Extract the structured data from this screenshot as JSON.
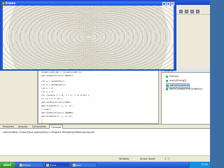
{
  "frame": {
    "title": "Frame",
    "buttons": {
      "minimize": "_",
      "maximize": "□",
      "close": "×"
    }
  },
  "editor": {
    "lines": [
      "Graphics2D g2d = (Graphics2D) g;",
      "g2d.setPaint(Color.WHITE);",
      "int w = getWidth();",
      "int h = getHeight();",
      "int x = 0;",
      "int y = 0;",
      "for (double f = 0; f < 1; f += 0.01) {",
      "  if (f % 2 == 0) {",
      "    g2d.setPaint(Color.RED);",
      "    g2d.drawOval(x, y, w, h);",
      "  } else {",
      "    g2d.setPaint(Color.GREEN);",
      "    g2d.drawOval(x, y, w, h);",
      "  }",
      "}"
    ]
  },
  "outline": {
    "tab_label": "Outline",
    "items": [
      {
        "label": "Frame()"
      },
      {
        "label": "main(String[])"
      },
      {
        "label": "paint(Graphics)"
      },
      {
        "label": "paintComponent(Graphics)"
      }
    ]
  },
  "console": {
    "tabs": [
      "Problems",
      "Javadoc",
      "Declaration",
      "Console"
    ],
    "active_tab": "Console",
    "line": "<terminated> Frame [Java Application] C:\\Program Files\\Java\\jre6\\bin\\javaw.exe"
  },
  "status": {
    "writable": "Writable",
    "insert": "Smart Insert",
    "position": "1 : 1"
  },
  "taskbar": {
    "start": "start",
    "tasks": [
      {
        "label": "Eclipse"
      },
      {
        "label": "Frame"
      },
      {
        "label": "Java"
      }
    ],
    "clock": "12:00"
  },
  "colors": {
    "ring_a": "#c8a8a0",
    "ring_b": "#a8c0a0",
    "canvas_bg": "#f6f4ef"
  }
}
